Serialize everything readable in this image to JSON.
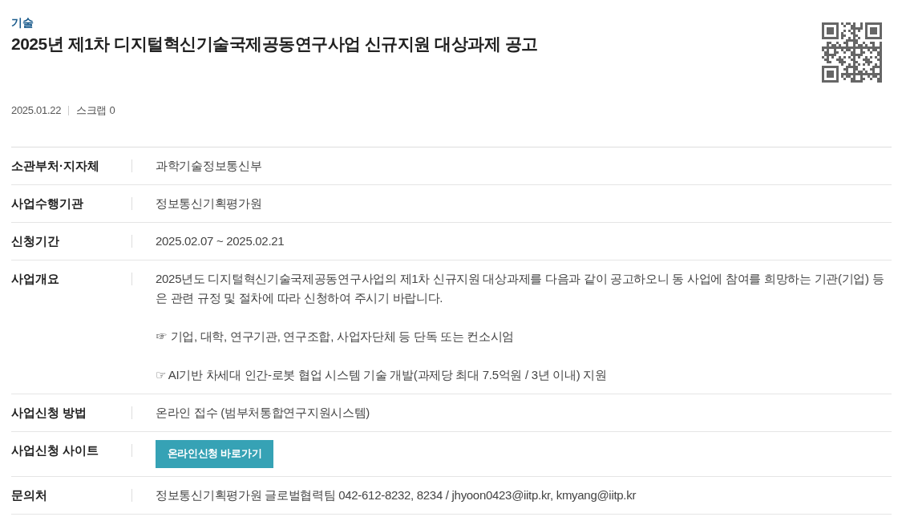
{
  "category": "기술",
  "title": "2025년 제1차 디지털혁신기술국제공동연구사업 신규지원 대상과제 공고",
  "date": "2025.01.22",
  "scrap": "스크랩 0",
  "rows": [
    {
      "kind": "text",
      "label": "소관부처·지자체",
      "value": "과학기술정보통신부"
    },
    {
      "kind": "text",
      "label": "사업수행기관",
      "value": "정보통신기획평가원"
    },
    {
      "kind": "text",
      "label": "신청기간",
      "value": "2025.02.07 ~ 2025.02.21"
    },
    {
      "kind": "paragraphs",
      "label": "사업개요",
      "paragraphs": [
        "2025년도 디지털혁신기술국제공동연구사업의 제1차 신규지원 대상과제를 다음과 같이 공고하오니 동 사업에 참여를 희망하는 기관(기업) 등은 관련 규정 및 절차에 따라 신청하여 주시기 바랍니다.",
        "☞ 기업, 대학, 연구기관, 연구조합, 사업자단체 등 단독 또는 컨소시엄",
        "☞ AI기반 차세대 인간-로봇 협업 시스템 기술 개발(과제당 최대 7.5억원 / 3년 이내) 지원"
      ]
    },
    {
      "kind": "text",
      "label": "사업신청 방법",
      "value": "온라인 접수 (범부처통합연구지원시스템)"
    },
    {
      "kind": "button",
      "label": "사업신청 사이트",
      "button": "온라인신청 바로가기"
    },
    {
      "kind": "text",
      "label": "문의처",
      "value": "정보통신기획평가원 글로벌협력팀 042-612-8232, 8234 / jhyoon0423@iitp.kr, kmyang@iitp.kr"
    }
  ]
}
